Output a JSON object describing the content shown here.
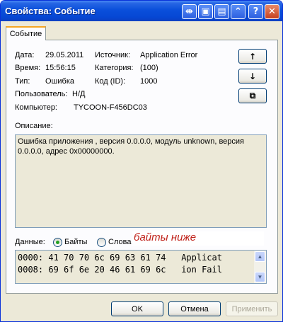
{
  "window": {
    "title": "Свойства: Событие"
  },
  "tabs": [
    {
      "label": "Событие"
    }
  ],
  "event": {
    "date_label": "Дата:",
    "date": "29.05.2011",
    "source_label": "Источник:",
    "source": "Application Error",
    "time_label": "Время:",
    "time": "15:56:15",
    "category_label": "Категория:",
    "category": "(100)",
    "type_label": "Тип:",
    "type": "Ошибка",
    "id_label": "Код (ID):",
    "id": "1000",
    "user_label": "Пользователь:",
    "user": "Н/Д",
    "computer_label": "Компьютер:",
    "computer": "TYCOON-F456DC03"
  },
  "nav": {
    "up": "↑",
    "down": "↓",
    "copy": "⧉"
  },
  "description": {
    "label": "Описание:",
    "text": "Ошибка приложения , версия 0.0.0.0, модуль unknown, версия 0.0.0.0, адрес 0x00000000."
  },
  "data_section": {
    "label": "Данные:",
    "bytes_option": "Байты",
    "words_option": "Слова",
    "selected": "bytes",
    "annotation": "байты ниже",
    "rows": [
      "0000: 41 70 70 6c 69 63 61 74   Applicat",
      "0008: 69 6f 6e 20 46 61 69 6c   ion Fail"
    ]
  },
  "buttons": {
    "ok": "OK",
    "cancel": "Отмена",
    "apply": "Применить"
  },
  "colors": {
    "title_bar": "#0a4fdb",
    "annotation": "#c0221a",
    "tab_accent": "#f5a623"
  },
  "icons": {
    "up": "arrow-up-icon",
    "down": "arrow-down-icon",
    "copy": "copy-icon"
  }
}
